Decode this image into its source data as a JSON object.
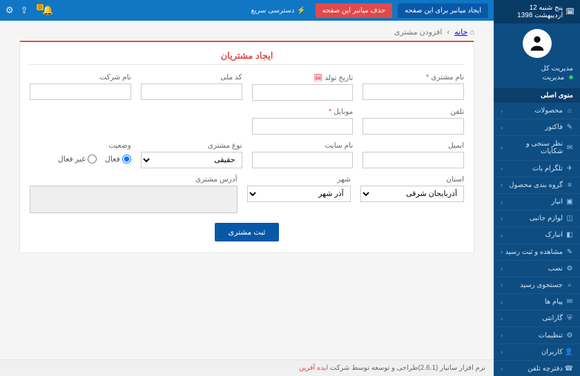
{
  "topbar": {
    "date_text": "پنج شنبه 12 اردیبهشت 1398",
    "btn_create_shortcut": "ایجاد میانبر برای این صفحه",
    "btn_delete_shortcut": "حذف میانبر این صفحه",
    "quick_access": "دسترسی سریع",
    "notif_badge": "0"
  },
  "sidebar": {
    "user_role": "مدیریت کل",
    "user_status": "مدیریت",
    "menu_heading": "منوی اصلی",
    "items": [
      {
        "label": "محصولات",
        "icon": "⌂"
      },
      {
        "label": "فاکتور",
        "icon": "✎"
      },
      {
        "label": "نظر سنجی و شکایات",
        "icon": "✉"
      },
      {
        "label": "تلگرام بات",
        "icon": "✈"
      },
      {
        "label": "گروه بندی محصول",
        "icon": "≡"
      },
      {
        "label": "انبار",
        "icon": "▣"
      },
      {
        "label": "لوازم جانبی",
        "icon": "◫"
      },
      {
        "label": "انبارک",
        "icon": "◧"
      },
      {
        "label": "مشاهده و ثبت رسید",
        "icon": "✎"
      },
      {
        "label": "نصب",
        "icon": "⚙"
      },
      {
        "label": "جستجوی رسید",
        "icon": "⌕"
      },
      {
        "label": "پیام ها",
        "icon": "✉"
      },
      {
        "label": "گارانتی",
        "icon": "⛨"
      },
      {
        "label": "تنظیمات",
        "icon": "⚙"
      },
      {
        "label": "کاربران",
        "icon": "👤"
      },
      {
        "label": "دفترچه تلفن",
        "icon": "☎"
      }
    ]
  },
  "breadcrumb": {
    "home": "خانه",
    "current": "افزودن مشتری"
  },
  "form": {
    "title": "ایجاد مشتریان",
    "labels": {
      "customer_name": "نام مشتری",
      "birth_date": "تاریخ تولد",
      "national_id": "کد ملی",
      "company_name": "نام شرکت",
      "phone": "تلفن",
      "mobile": "موبایل",
      "email": "ایمیل",
      "website": "نام سایت",
      "customer_type": "نوع مشتری",
      "status": "وضعیت",
      "province": "استان",
      "city": "شهر",
      "customer_address": "آدرس مشتری"
    },
    "values": {
      "customer_type_selected": "حقیقی",
      "province_selected": "آذربایجان شرقی",
      "city_selected": "آذر شهر"
    },
    "status_options": {
      "active": "فعال",
      "inactive": "غیر فعال"
    },
    "submit": "ثبت مشتری"
  },
  "footer": {
    "text_prefix": "نرم افزار سانیار (2.6.1)طراحی و توسعه توسط شرکت ",
    "brand": "ایده آفرین"
  }
}
